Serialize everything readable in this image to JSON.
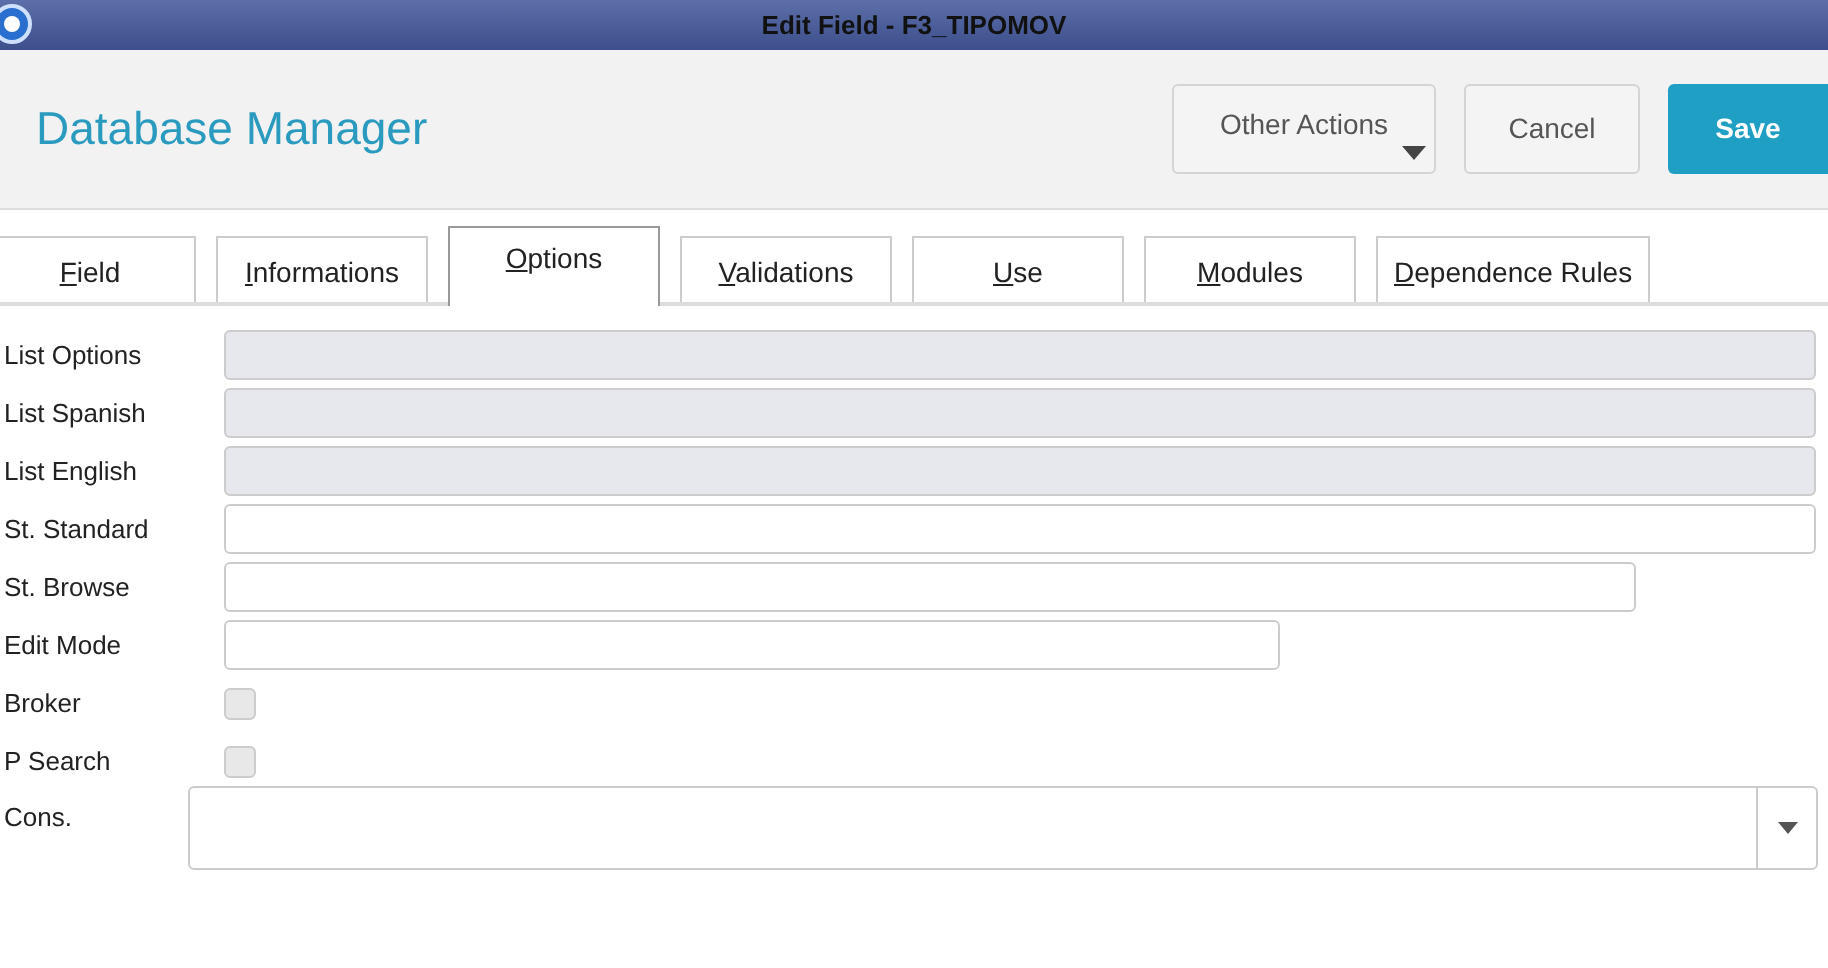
{
  "window": {
    "title": "Edit Field - F3_TIPOMOV"
  },
  "header": {
    "title": "Database Manager",
    "buttons": [
      {
        "label": "Other Actions",
        "kind": "menu"
      },
      {
        "label": "Cancel",
        "kind": "plain"
      },
      {
        "label": "Save",
        "kind": "primary"
      }
    ]
  },
  "tabs": [
    {
      "label": "Field",
      "selected": false
    },
    {
      "label": "Informations",
      "selected": false
    },
    {
      "label": "Options",
      "selected": true
    },
    {
      "label": "Validations",
      "selected": false
    },
    {
      "label": "Use",
      "selected": false
    },
    {
      "label": "Modules",
      "selected": false
    },
    {
      "label": "Dependence Rules",
      "selected": false
    }
  ],
  "fields": [
    {
      "label": "List Options",
      "kind": "text",
      "disabled": true
    },
    {
      "label": "List Spanish",
      "kind": "text",
      "disabled": true
    },
    {
      "label": "List English",
      "kind": "text",
      "disabled": true
    },
    {
      "label": "St. Standard",
      "kind": "text",
      "disabled": false
    },
    {
      "label": "St. Browse",
      "kind": "text",
      "disabled": false
    },
    {
      "label": "Edit Mode",
      "kind": "text",
      "disabled": false
    },
    {
      "label": "Broker",
      "kind": "checkbox",
      "checked": false
    },
    {
      "label": "P Search",
      "kind": "checkbox",
      "checked": false
    },
    {
      "label": "Cons.",
      "kind": "combo"
    }
  ]
}
